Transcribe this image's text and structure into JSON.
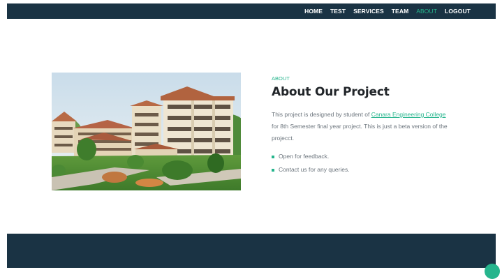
{
  "nav": {
    "items": [
      {
        "label": "HOME"
      },
      {
        "label": "TEST"
      },
      {
        "label": "SERVICES"
      },
      {
        "label": "TEAM"
      },
      {
        "label": "ABOUT",
        "active": true
      },
      {
        "label": "LOGOUT"
      }
    ]
  },
  "about": {
    "eyebrow": "ABOUT",
    "title": "About Our Project",
    "desc_before": "This project is designed by student of ",
    "desc_link": "Canara Engineering College",
    "desc_after": " for 8th Semester final year project. This is just a beta version of the projecct.",
    "features": [
      "Open for feedback.",
      "Contact us for any queries."
    ]
  },
  "colors": {
    "navbar": "#1a3344",
    "accent": "#26b58d",
    "text_muted": "#6c757d",
    "heading": "#212529"
  }
}
